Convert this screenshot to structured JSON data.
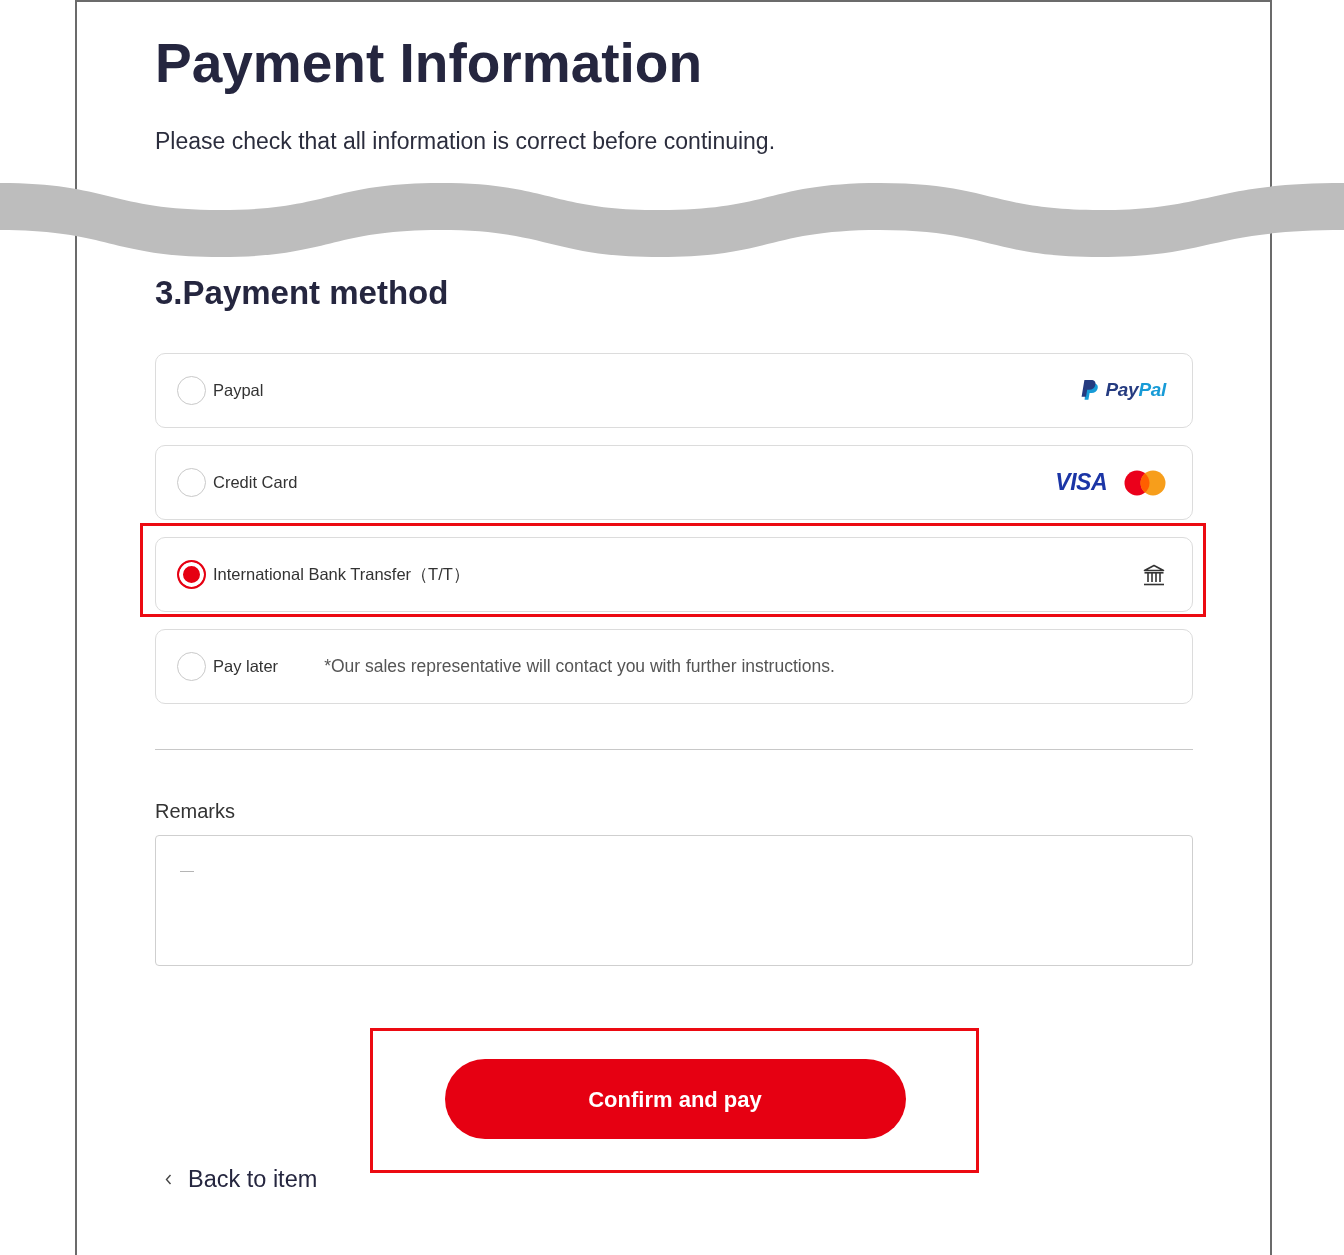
{
  "page": {
    "title": "Payment Information",
    "subtitle": "Please check that all information is correct before continuing."
  },
  "payment_method": {
    "heading": "3.Payment method",
    "options": [
      {
        "kind": "paypal",
        "label": "Paypal",
        "selected": false,
        "highlighted": false,
        "wordmark": [
          {
            "text": "Pay",
            "color": "#253b80"
          },
          {
            "text": "Pal",
            "color": "#179bd7"
          }
        ]
      },
      {
        "kind": "card",
        "label": "Credit Card",
        "selected": false,
        "highlighted": false,
        "brand": "VISA"
      },
      {
        "kind": "bank",
        "label": "International Bank Transfer（T/T）",
        "selected": true,
        "highlighted": true
      },
      {
        "kind": "later",
        "label": "Pay later",
        "selected": false,
        "highlighted": false,
        "note": "*Our sales representative will contact you with further instructions."
      }
    ]
  },
  "remarks": {
    "label": "Remarks",
    "placeholder": "—"
  },
  "confirm_button": {
    "label": "Confirm and pay",
    "highlighted": true
  },
  "back_link": {
    "label": "Back to item"
  }
}
